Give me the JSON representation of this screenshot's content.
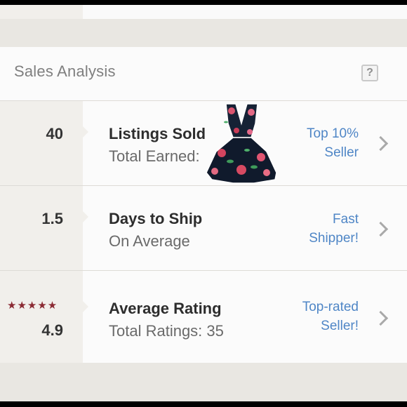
{
  "header": {
    "title": "Sales Analysis",
    "help_label": "?"
  },
  "rows": [
    {
      "metric": "40",
      "main": "Listings Sold",
      "sub": "Total Earned:",
      "badge_line1": "Top 10%",
      "badge_line2": "Seller"
    },
    {
      "metric": "1.5",
      "main": "Days to Ship",
      "sub": "On Average",
      "badge_line1": "Fast",
      "badge_line2": "Shipper!"
    },
    {
      "metric": "4.9",
      "stars": "★★★★★",
      "main": "Average Rating",
      "sub": "Total Ratings: 35",
      "badge_line1": "Top-rated",
      "badge_line2": "Seller!"
    }
  ],
  "colors": {
    "badge": "#4f86c6",
    "stars": "#8b2a33",
    "background": "#e9e7e2"
  },
  "icons": {
    "help": "question-mark-icon",
    "chevron": "chevron-right-icon",
    "star": "star-icon"
  }
}
